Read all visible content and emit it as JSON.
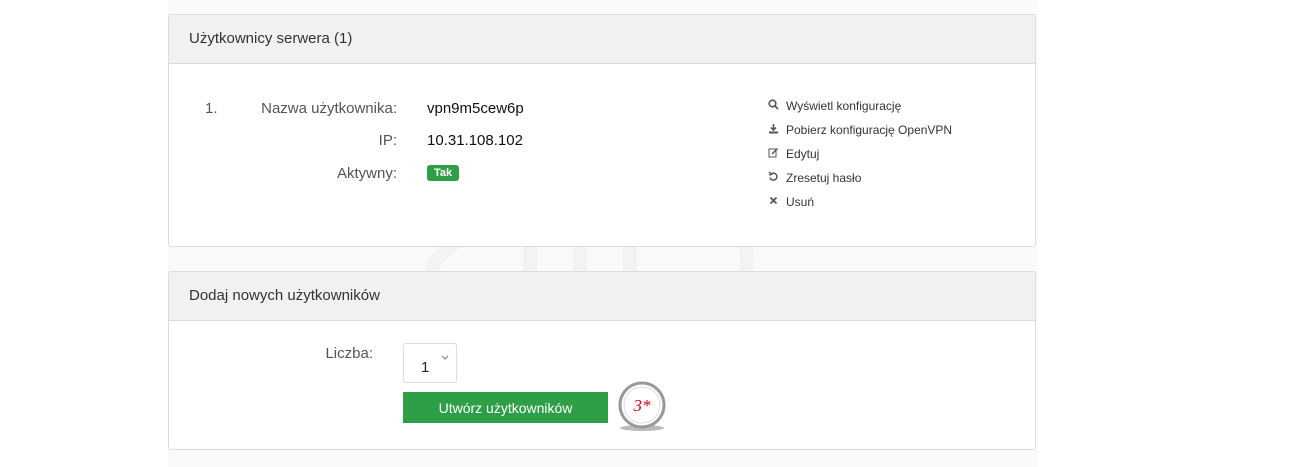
{
  "panel_users": {
    "title": "Użytkownicy serwera (1)",
    "users": [
      {
        "index": "1.",
        "username_label": "Nazwa użytkownika:",
        "username": "vpn9m5cew6p",
        "ip_label": "IP:",
        "ip": "10.31.108.102",
        "active_label": "Aktywny:",
        "active": "Tak",
        "actions": {
          "view": "Wyświetl konfigurację",
          "download": "Pobierz konfigurację OpenVPN",
          "edit": "Edytuj",
          "reset": "Zresetuj hasło",
          "delete": "Usuń"
        }
      }
    ]
  },
  "panel_add": {
    "title": "Dodaj nowych użytkowników",
    "count_label": "Liczba:",
    "count_value": "1",
    "create_button": "Utwórz użytkowników"
  },
  "step_marker": "3*",
  "colors": {
    "accent": "#2e9e47",
    "marker": "#d0021b"
  },
  "icons": [
    "search-icon",
    "download-icon",
    "edit-icon",
    "undo-icon",
    "close-icon",
    "chevron-down-icon"
  ]
}
